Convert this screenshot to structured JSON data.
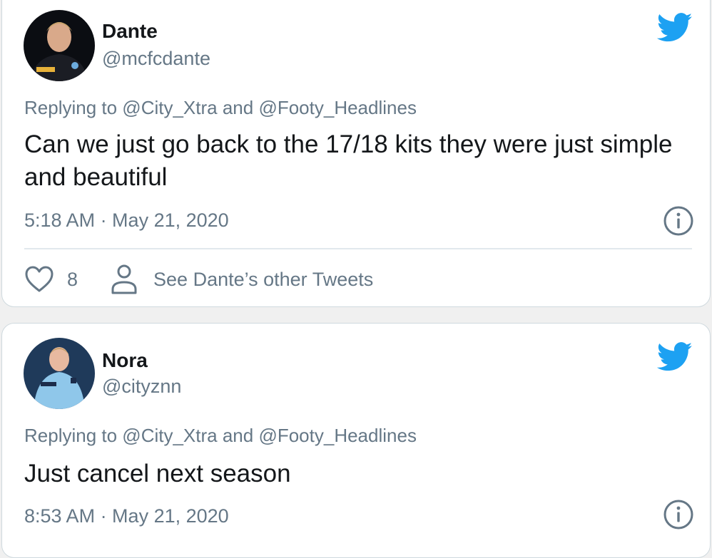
{
  "tweets": [
    {
      "name": "Dante",
      "handle": "@mcfcdante",
      "replying": "Replying to @City_Xtra and @Footy_Headlines",
      "text": "Can we just go back to the 17/18 kits they were just simple and beautiful",
      "time": "5:18 AM · May 21, 2020",
      "likes": "8",
      "other_tweets": "See Dante’s other Tweets",
      "avatar_icon": "avatar-photo"
    },
    {
      "name": "Nora",
      "handle": "@cityznn",
      "replying": "Replying to @City_Xtra and @Footy_Headlines",
      "text": "Just cancel next season",
      "time": "8:53 AM · May 21, 2020",
      "avatar_icon": "avatar-photo"
    }
  ],
  "colors": {
    "twitter_blue": "#1da1f2",
    "secondary_text": "#657786",
    "primary_text": "#14171a",
    "card_border": "#cfd9de"
  }
}
